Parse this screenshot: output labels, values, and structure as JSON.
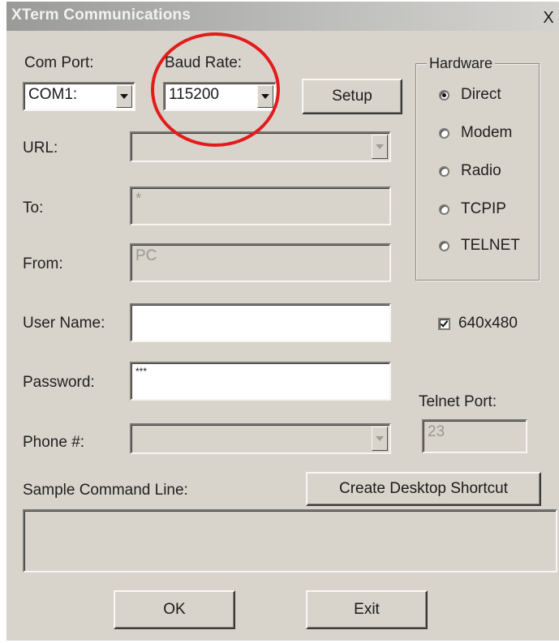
{
  "window": {
    "title": "XTerm Communications",
    "close_label": "X"
  },
  "com_port": {
    "label": "Com Port:",
    "value": "COM1:"
  },
  "baud_rate": {
    "label": "Baud Rate:",
    "value": "115200"
  },
  "setup_button": "Setup",
  "url": {
    "label": "URL:",
    "value": ""
  },
  "to": {
    "label": "To:",
    "value": "*"
  },
  "from": {
    "label": "From:",
    "value": "PC"
  },
  "user_name": {
    "label": "User Name:",
    "value": ""
  },
  "password": {
    "label": "Password:",
    "value": "***"
  },
  "phone": {
    "label": "Phone #:",
    "value": ""
  },
  "hardware": {
    "legend": "Hardware",
    "options": [
      "Direct",
      "Modem",
      "Radio",
      "TCPIP",
      "TELNET"
    ],
    "selected": "Direct"
  },
  "resolution_checkbox": {
    "label": "640x480",
    "checked": true
  },
  "telnet_port": {
    "label": "Telnet Port:",
    "value": "23"
  },
  "sample_command": {
    "label": "Sample Command Line:",
    "value": ""
  },
  "create_shortcut_button": "Create Desktop Shortcut",
  "ok_button": "OK",
  "exit_button": "Exit",
  "annotation": {
    "color": "#e31b1b"
  }
}
